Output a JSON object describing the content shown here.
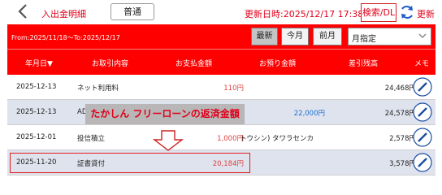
{
  "header": {
    "title": "入出金明細",
    "mode": "普通",
    "updated": "更新日時:2025/12/17 17:38",
    "search": "検索/DL",
    "refresh": "更新"
  },
  "filter": {
    "range": "From:2025/11/18～To:2025/12/17",
    "buttons": [
      "最新",
      "今月",
      "前月"
    ],
    "active": "最新",
    "select_value": "月指定"
  },
  "columns": [
    "年月日▼",
    "お取引内容",
    "お支払金額",
    "お預り金額",
    "差引残高",
    "メモ"
  ],
  "rows": [
    {
      "date": "2025-12-13",
      "desc": "ネット利用料",
      "pay": "110円",
      "dep": "",
      "bal": "24,468円"
    },
    {
      "date": "2025-12-13",
      "desc": "AD",
      "pay": "",
      "dep": "22,000円",
      "bal": "24,578円"
    },
    {
      "date": "2025-12-01",
      "desc": "投信積立",
      "pay": "1,000円",
      "dep": "トウシン) タワラセンカ",
      "bal": "2,578円"
    },
    {
      "date": "2025-11-20",
      "desc": "証書貸付",
      "pay": "20,184円",
      "dep": "",
      "bal": "3,578円"
    }
  ],
  "annotation": "たかしん フリーローンの返済金額",
  "colors": {
    "accent": "#ff0000",
    "row_alt": "#dfe3ee",
    "deposit": "#1a6fd0",
    "payment": "#e04040"
  }
}
